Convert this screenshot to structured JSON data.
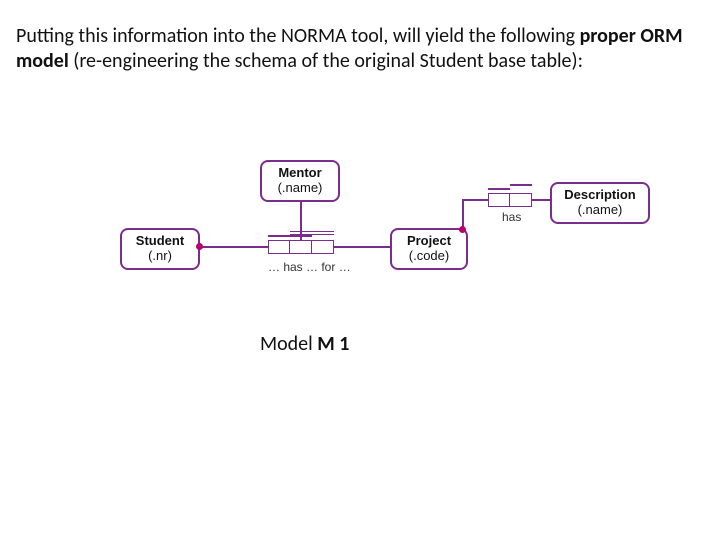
{
  "intro": {
    "pre": "Putting this information into the NORMA tool, will yield the following ",
    "bold": "proper ORM model",
    "post": "  (re-engineering the schema of the original Student base table):"
  },
  "caption": {
    "prefix": "Model ",
    "name": "M 1"
  },
  "entities": {
    "student": {
      "name": "Student",
      "ref": "(.nr)"
    },
    "mentor": {
      "name": "Mentor",
      "ref": "(.name)"
    },
    "project": {
      "name": "Project",
      "ref": "(.code)"
    },
    "description": {
      "name": "Description",
      "ref": "(.name)"
    }
  },
  "readings": {
    "ternary": "… has … for …",
    "has": "has"
  }
}
